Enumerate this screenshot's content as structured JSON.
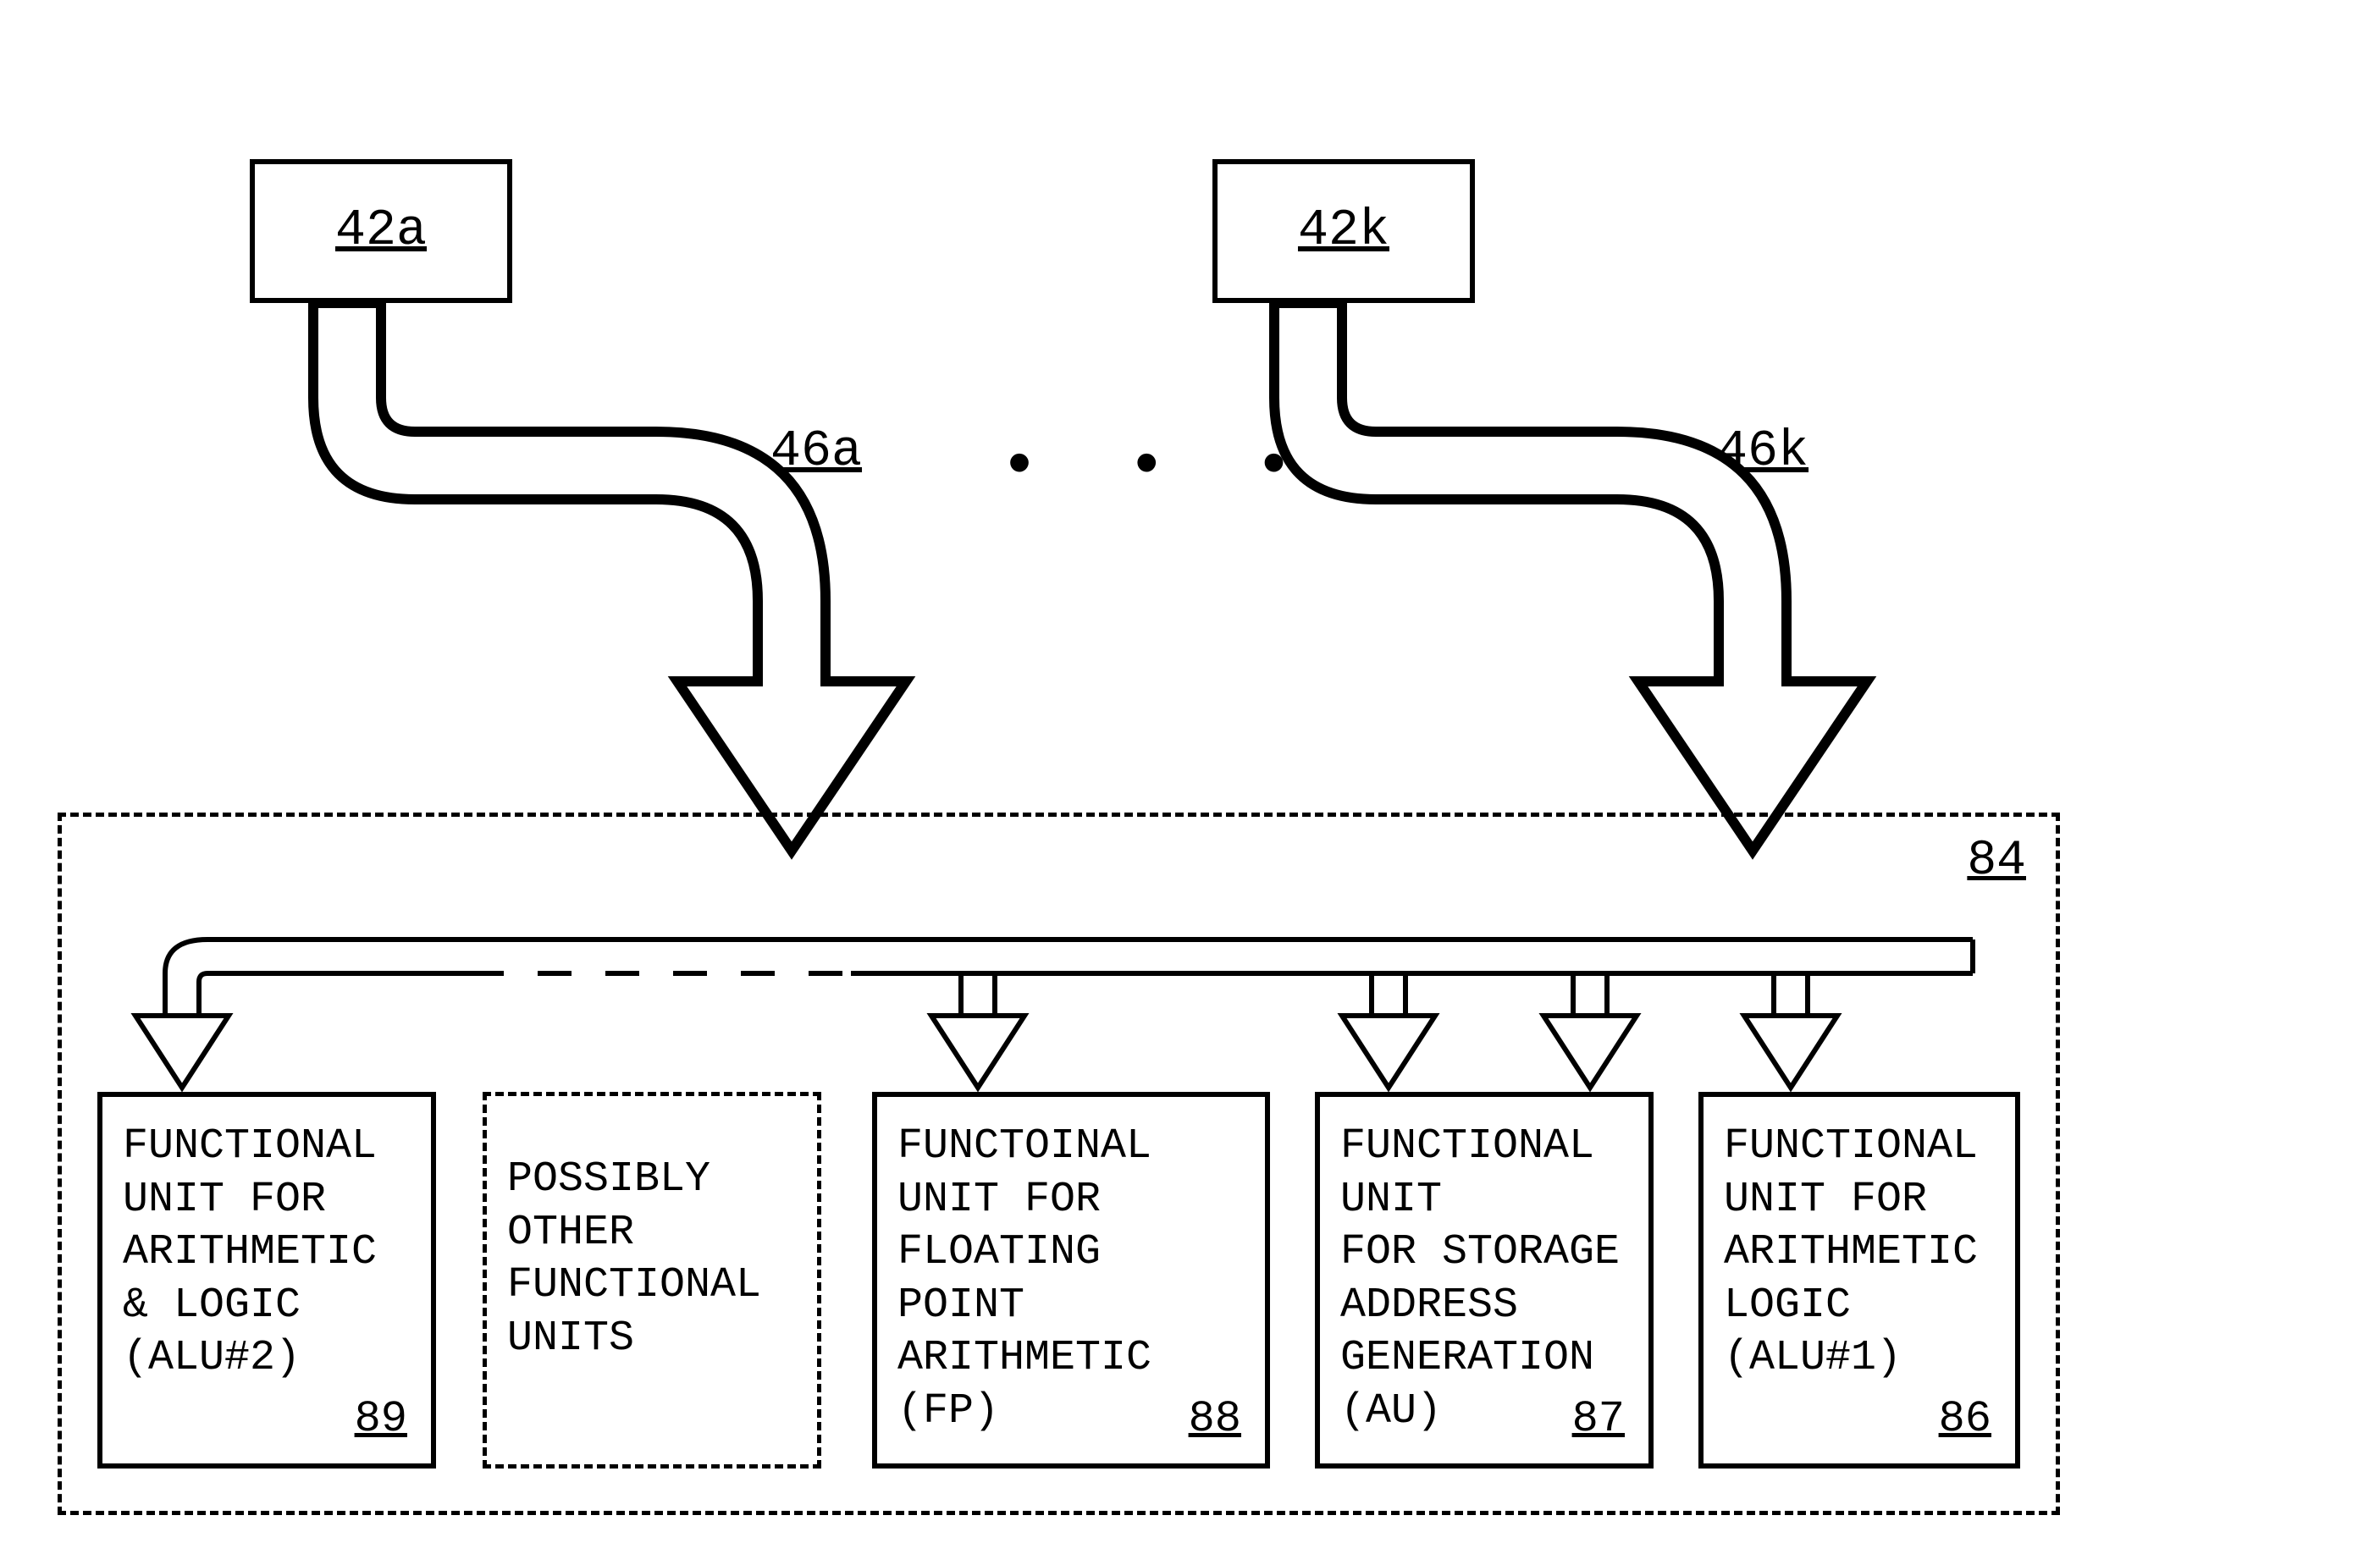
{
  "top_boxes": {
    "left": {
      "label": "42a"
    },
    "right": {
      "label": "42k"
    }
  },
  "arrows": {
    "left_label": "46a",
    "right_label": "46k",
    "dots": "•   •   •"
  },
  "container": {
    "ref": "84"
  },
  "units": [
    {
      "id": "alu2",
      "text": "FUNCTIONAL\nUNIT FOR\nARITHMETIC\n& LOGIC\n(ALU#2)",
      "ref": "89"
    },
    {
      "id": "other",
      "text": "POSSIBLY\nOTHER\nFUNCTIONAL\nUNITS",
      "ref": ""
    },
    {
      "id": "fp",
      "text": "FUNCTOINAL\nUNIT FOR\nFLOATING POINT\nARITHMETIC\n(FP)",
      "ref": "88"
    },
    {
      "id": "au",
      "text": "FUNCTIONAL\nUNIT\nFOR STORAGE\nADDRESS\nGENERATION\n(AU)",
      "ref": "87"
    },
    {
      "id": "alu1",
      "text": "FUNCTIONAL\nUNIT FOR\nARITHMETIC\nLOGIC\n(ALU#1)",
      "ref": "86"
    }
  ]
}
